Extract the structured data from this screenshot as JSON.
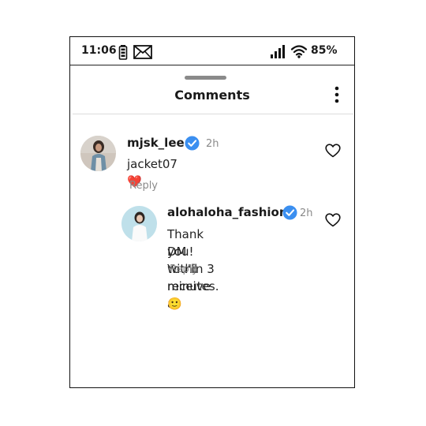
{
  "status_bar": {
    "time": "11:06",
    "battery_percent": "85%",
    "icons": [
      "battery-icon",
      "mail-icon",
      "signal-icon",
      "wifi-icon"
    ]
  },
  "sheet": {
    "title": "Comments",
    "menu_icon": "more-vertical-icon"
  },
  "comments": [
    {
      "username": "mjsk_lee",
      "verified": true,
      "time_ago": "2h",
      "text": "jacket07 ❤️",
      "reply_label": "Reply",
      "liked": false
    }
  ],
  "replies": [
    {
      "username": "alohaloha_fashion",
      "verified": true,
      "time_ago": "2h",
      "text_line1": "Thank you! You'll receive a",
      "text_line2": "DM within 3 minutes. 🙂",
      "reply_label": "Reply",
      "liked": false
    }
  ],
  "colors": {
    "verified": "#3b8ff0",
    "heart_emoji": "#e0243c",
    "muted_text": "#8a8a8a"
  }
}
